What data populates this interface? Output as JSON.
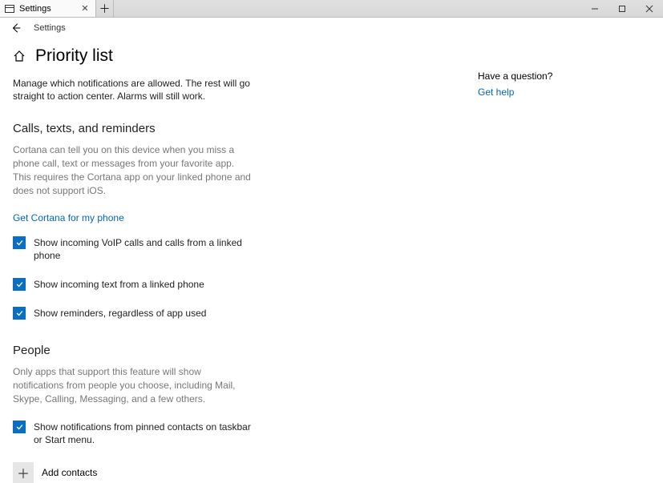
{
  "titlebar": {
    "tab_label": "Settings",
    "min_tooltip": "Minimize",
    "max_tooltip": "Maximize",
    "close_tooltip": "Close"
  },
  "breadcrumb": {
    "label": "Settings"
  },
  "page": {
    "title": "Priority list",
    "description": "Manage which notifications are allowed. The rest will go straight to action center. Alarms will still work."
  },
  "section_calls": {
    "title": "Calls, texts, and reminders",
    "desc": "Cortana can tell you on this device when you miss a phone call, text or messages from your favorite app. This requires the Cortana app on your linked phone and does not support iOS.",
    "get_cortana_link": "Get Cortana for my phone",
    "cb_voip": "Show incoming VoIP calls and calls from a linked phone",
    "cb_text": "Show incoming text from a linked phone",
    "cb_reminders": "Show reminders, regardless of app used"
  },
  "section_people": {
    "title": "People",
    "desc": "Only apps that support this feature will show notifications from people you choose, including Mail, Skype, Calling, Messaging, and a few others.",
    "cb_pinned": "Show notifications from pinned contacts on taskbar or Start menu.",
    "add_label": "Add contacts"
  },
  "side": {
    "question": "Have a question?",
    "get_help": "Get help"
  }
}
